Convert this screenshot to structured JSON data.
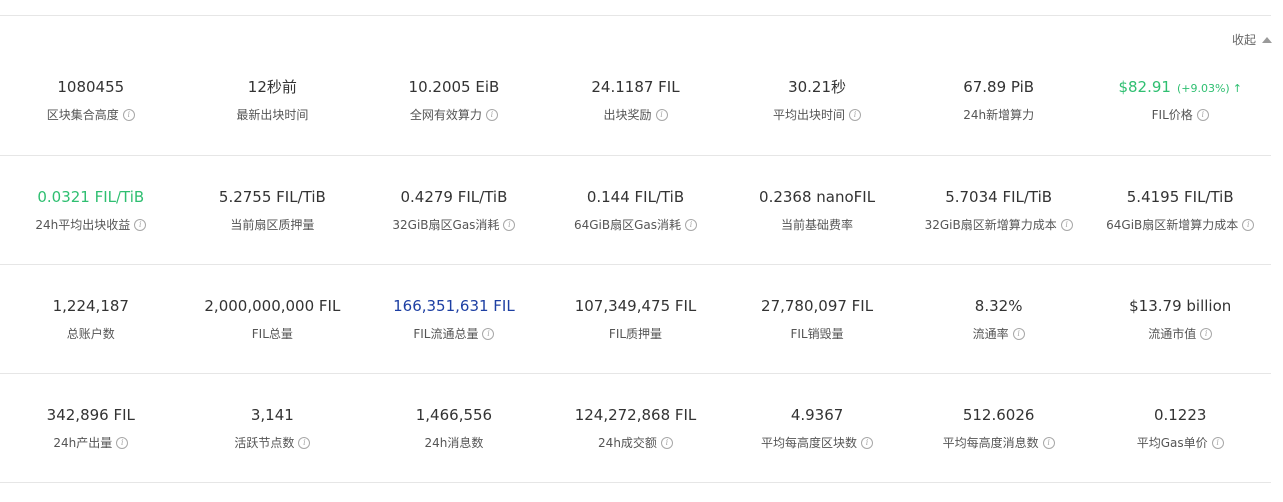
{
  "header": {
    "collapse_label": "收起",
    "collapse_icon": "triangle-up-icon"
  },
  "colors": {
    "green": "#2fbf71",
    "blue": "#1d3fa3",
    "divider": "#e6e6e6"
  },
  "rows": [
    [
      {
        "value": "1080455",
        "label": "区块集合高度",
        "info": true
      },
      {
        "value": "12秒前",
        "label": "最新出块时间",
        "info": false
      },
      {
        "value": "10.2005 EiB",
        "label": "全网有效算力",
        "info": true
      },
      {
        "value": "24.1187 FIL",
        "label": "出块奖励",
        "info": true
      },
      {
        "value": "30.21秒",
        "label": "平均出块时间",
        "info": true
      },
      {
        "value": "67.89 PiB",
        "label": "24h新增算力",
        "info": false
      },
      {
        "value": "$82.91",
        "change": "(+9.03%)",
        "arrow": "↑",
        "label": "FIL价格",
        "info": true,
        "color": "green"
      }
    ],
    [
      {
        "value": "0.0321 FIL/TiB",
        "label": "24h平均出块收益",
        "info": true,
        "color": "green"
      },
      {
        "value": "5.2755 FIL/TiB",
        "label": "当前扇区质押量",
        "info": false
      },
      {
        "value": "0.4279 FIL/TiB",
        "label": "32GiB扇区Gas消耗",
        "info": true
      },
      {
        "value": "0.144 FIL/TiB",
        "label": "64GiB扇区Gas消耗",
        "info": true
      },
      {
        "value": "0.2368 nanoFIL",
        "label": "当前基础费率",
        "info": false
      },
      {
        "value": "5.7034 FIL/TiB",
        "label": "32GiB扇区新增算力成本",
        "info": true
      },
      {
        "value": "5.4195 FIL/TiB",
        "label": "64GiB扇区新增算力成本",
        "info": true
      }
    ],
    [
      {
        "value": "1,224,187",
        "label": "总账户数",
        "info": false
      },
      {
        "value": "2,000,000,000 FIL",
        "label": "FIL总量",
        "info": false
      },
      {
        "value": "166,351,631 FIL",
        "label": "FIL流通总量",
        "info": true,
        "color": "blue"
      },
      {
        "value": "107,349,475 FIL",
        "label": "FIL质押量",
        "info": false
      },
      {
        "value": "27,780,097 FIL",
        "label": "FIL销毁量",
        "info": false
      },
      {
        "value": "8.32%",
        "label": "流通率",
        "info": true
      },
      {
        "value": "$13.79 billion",
        "label": "流通市值",
        "info": true
      }
    ],
    [
      {
        "value": "342,896 FIL",
        "label": "24h产出量",
        "info": true
      },
      {
        "value": "3,141",
        "label": "活跃节点数",
        "info": true
      },
      {
        "value": "1,466,556",
        "label": "24h消息数",
        "info": false
      },
      {
        "value": "124,272,868 FIL",
        "label": "24h成交额",
        "info": true
      },
      {
        "value": "4.9367",
        "label": "平均每高度区块数",
        "info": true
      },
      {
        "value": "512.6026",
        "label": "平均每高度消息数",
        "info": true
      },
      {
        "value": "0.1223",
        "label": "平均Gas单价",
        "info": true
      }
    ]
  ]
}
